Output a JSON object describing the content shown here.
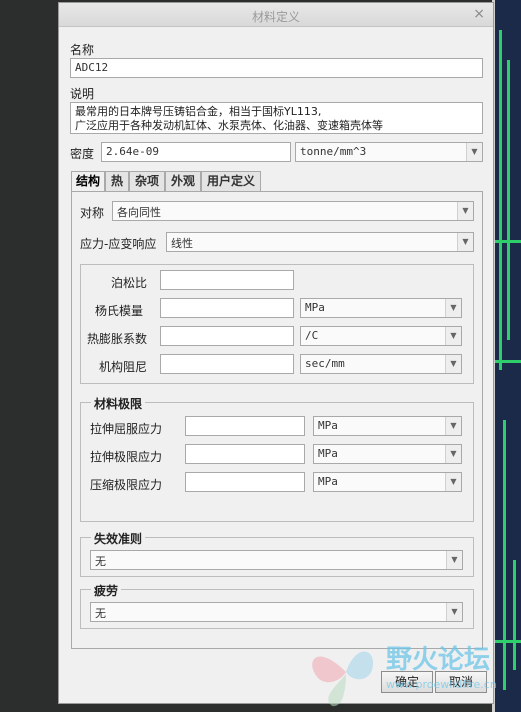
{
  "dialog": {
    "title": "材料定义",
    "close_glyph": "×",
    "name_label": "名称",
    "name_value": "ADC12",
    "desc_label": "说明",
    "desc_line1": "最常用的日本牌号压铸铝合金，相当于国标YL113,",
    "desc_line2": "广泛应用于各种发动机缸体、水泵壳体、化油器、变速箱壳体等",
    "density_label": "密度",
    "density_value": "2.64e-09",
    "density_unit": "tonne/mm^3"
  },
  "tabs": [
    "结构",
    "热",
    "杂项",
    "外观",
    "用户定义"
  ],
  "structure": {
    "symmetry_label": "对称",
    "symmetry_value": "各向同性",
    "stress_strain_label": "应力-应变响应",
    "stress_strain_value": "线性",
    "poisson_label": "泊松比",
    "youngs_label": "杨氏模量",
    "youngs_unit": "MPa",
    "thermal_label": "热膨胀系数",
    "thermal_unit": "/C",
    "damping_label": "机构阻尼",
    "damping_unit": "sec/mm"
  },
  "limits": {
    "title": "材料极限",
    "tensile_yield_label": "拉伸屈服应力",
    "tensile_yield_unit": "MPa",
    "tensile_ultimate_label": "拉伸极限应力",
    "tensile_ultimate_unit": "MPa",
    "compressive_label": "压缩极限应力",
    "compressive_unit": "MPa"
  },
  "failure": {
    "title": "失效准则",
    "value": "无"
  },
  "fatigue": {
    "title": "疲劳",
    "value": "无"
  },
  "buttons": {
    "ok": "确定",
    "cancel": "取消"
  },
  "watermark": {
    "text": "野火论坛",
    "url": "www.proewildfire.cn"
  },
  "colors": {
    "background": "#2c2e2d",
    "pcb": "#1c2a4a",
    "trace": "#2ecf6a",
    "watermark": "#6ec6e8"
  }
}
